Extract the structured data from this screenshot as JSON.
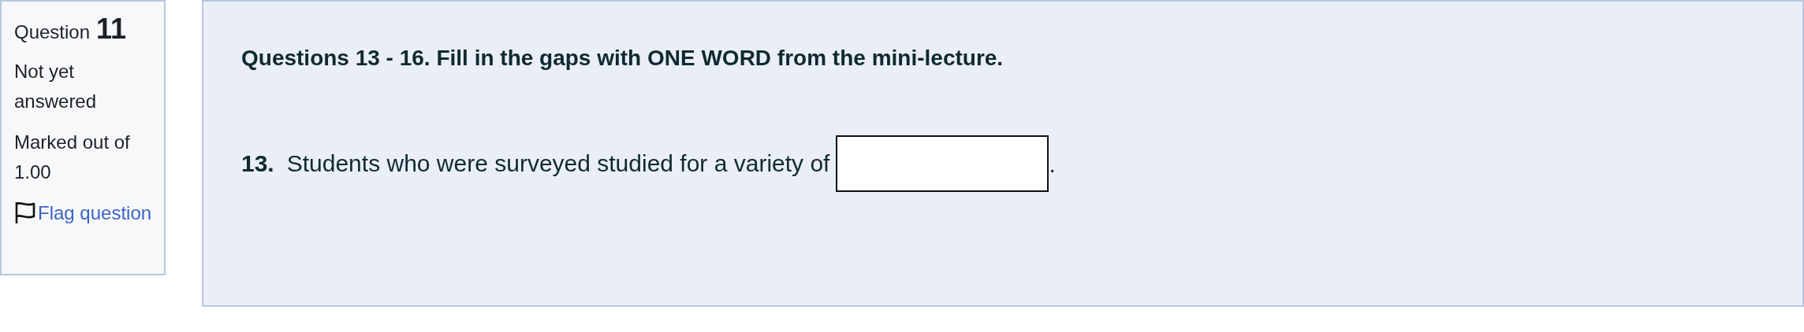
{
  "question_info": {
    "label": "Question",
    "number": "11",
    "state": "Not yet answered",
    "mark": "Marked out of 1.00",
    "flag_link": "Flag question"
  },
  "content": {
    "heading": "Questions 13 - 16. Fill in the gaps with ONE WORD from the mini-lecture.",
    "items": [
      {
        "number": "13.",
        "text": "Students who were surveyed studied for a variety of",
        "after": "."
      }
    ]
  }
}
